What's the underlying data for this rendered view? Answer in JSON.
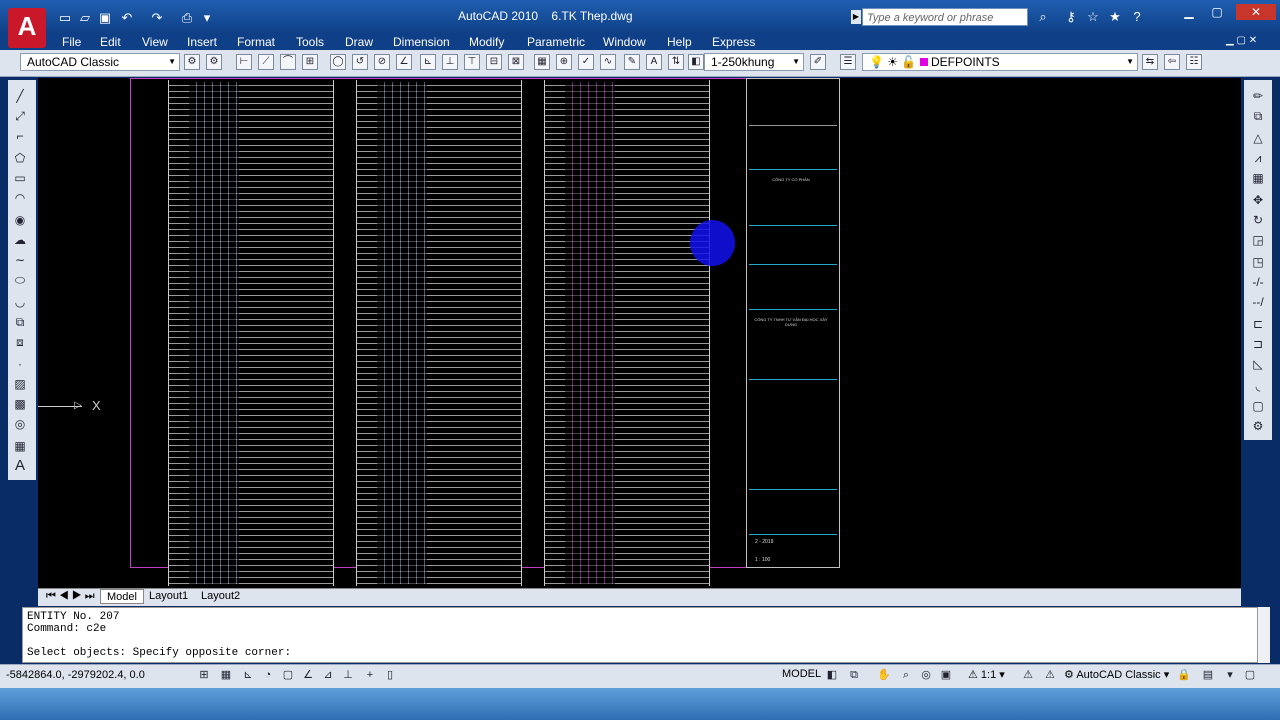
{
  "window": {
    "app_title": "AutoCAD 2010",
    "file_title": "6.TK Thep.dwg",
    "search_placeholder": "Type a keyword or phrase"
  },
  "menu": [
    "File",
    "Edit",
    "View",
    "Insert",
    "Format",
    "Tools",
    "Draw",
    "Dimension",
    "Modify",
    "Parametric",
    "Window",
    "Help",
    "Express"
  ],
  "toolbar": {
    "workspace": "AutoCAD Classic",
    "dimstyle": "1-250khung",
    "layer": "DEFPOINTS",
    "layer_color": "#e000e0"
  },
  "titleblock": {
    "company": "CÔNG TY CỔ PHẦN",
    "consultant": "CÔNG TY TNHH TƯ VẤN ĐẠI HỌC XÂY DỰNG",
    "date": "2 - 2019",
    "scale": "1 : 100"
  },
  "tabs": {
    "model": "Model",
    "layout1": "Layout1",
    "layout2": "Layout2"
  },
  "command": {
    "line1": "ENTITY No.   207",
    "line2": "Command: c2e",
    "line3": "Select objects: Specify opposite corner:"
  },
  "status": {
    "coords": "-5842864.0, -2979202.4, 0.0",
    "model_label": "MODEL",
    "scale": "1:1",
    "workspace": "AutoCAD Classic"
  },
  "colors": {
    "title_bar": "#1f5fb0",
    "canvas": "#000000",
    "sheet_border": "#c040c0"
  }
}
